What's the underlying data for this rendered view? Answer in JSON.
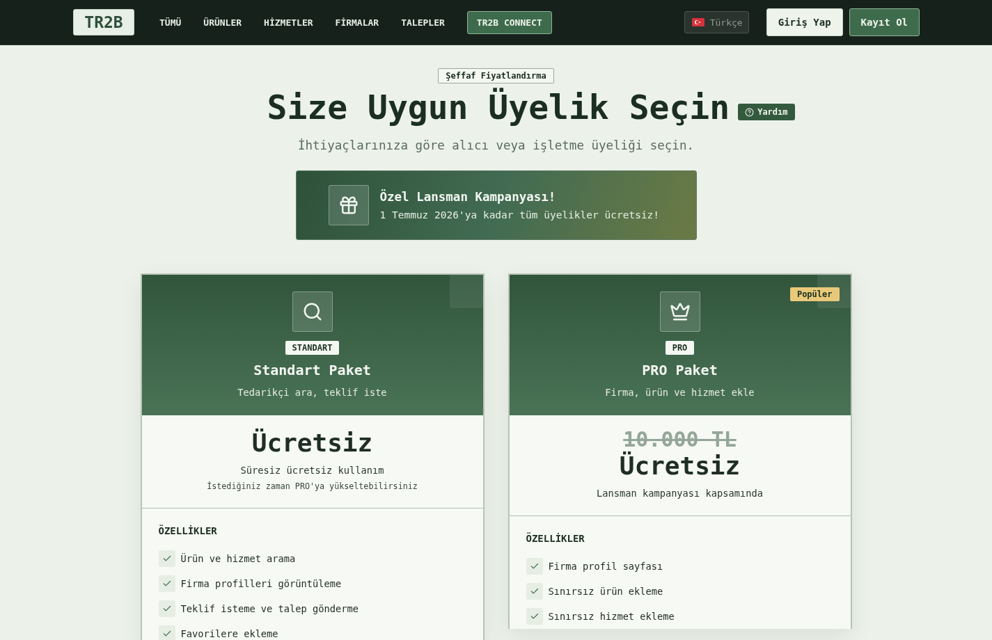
{
  "header": {
    "logo": "TR2B",
    "nav": [
      {
        "label": "TÜMÜ",
        "kind": "link"
      },
      {
        "label": "ÜRÜNLER",
        "kind": "link"
      },
      {
        "label": "HİZMETLER",
        "kind": "link"
      },
      {
        "label": "FİRMALAR",
        "kind": "link"
      },
      {
        "label": "TALEPLER",
        "kind": "link"
      },
      {
        "label": "TR2B CONNECT",
        "kind": "button"
      }
    ],
    "language": "Türkçe",
    "actions": [
      {
        "label": "Giriş Yap",
        "kind": "secondary"
      },
      {
        "label": "Kayıt Ol",
        "kind": "primary"
      }
    ]
  },
  "hero": {
    "badge": "Şeffaf Fiyatlandırma",
    "title": "Size Uygun Üyelik Seçin",
    "help": "Yardım",
    "subtitle": "İhtiyaçlarınıza göre alıcı veya işletme üyeliği seçin."
  },
  "campaign": {
    "title": "Özel Lansman Kampanyası!",
    "text": "1 Temmuz 2026'ya kadar tüm üyelikler ücretsiz!"
  },
  "plans": [
    {
      "kind": "standard",
      "tag": "STANDART",
      "name": "Standart Paket",
      "tagline": "Tedarikçi ara, teklif iste",
      "price": "Ücretsiz",
      "note": "Süresiz ücretsiz kullanım",
      "hint": "İstediğiniz zaman PRO'ya yükseltebilirsiniz",
      "features_title": "ÖZELLİKLER",
      "features": [
        "Ürün ve hizmet arama",
        "Firma profilleri görüntüleme",
        "Teklif isteme ve talep gönderme",
        "Favorilere ekleme"
      ]
    },
    {
      "kind": "pro",
      "ribbon": "Popüler",
      "tag": "PRO",
      "name": "PRO Paket",
      "tagline": "Firma, ürün ve hizmet ekle",
      "old_price": "10.000 TL",
      "price": "Ücretsiz",
      "note": "Lansman kampanyası kapsamında",
      "features_title": "ÖZELLİKLER",
      "features": [
        "Firma profil sayfası",
        "Sınırsız ürün ekleme",
        "Sınırsız hizmet ekleme"
      ]
    }
  ]
}
